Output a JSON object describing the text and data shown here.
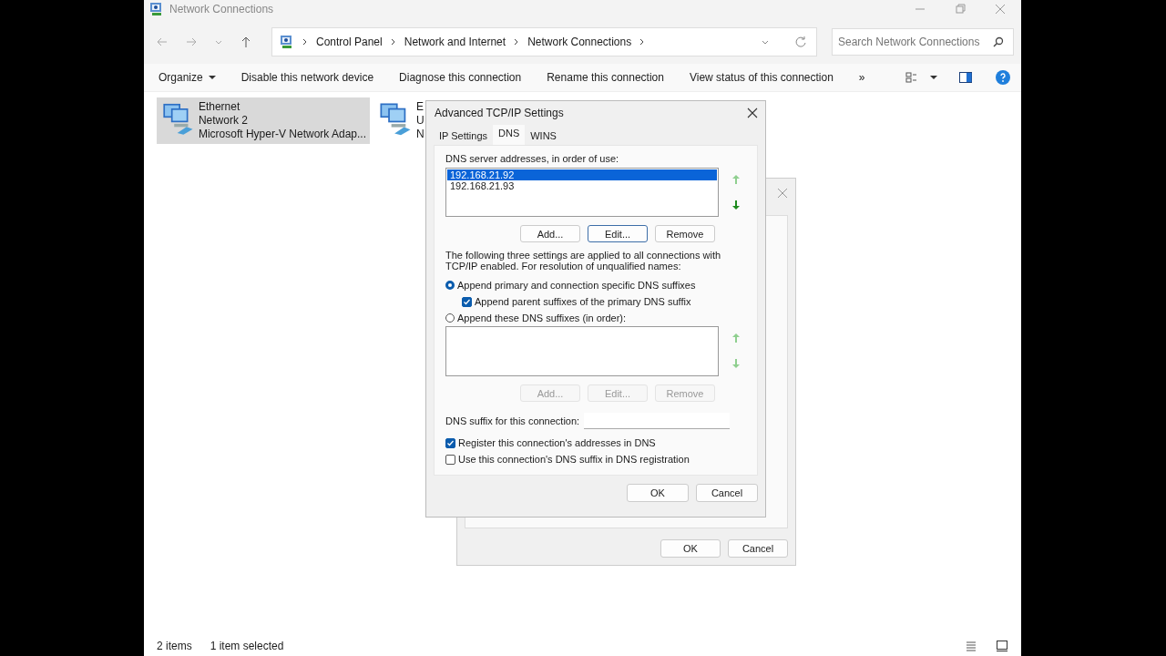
{
  "window": {
    "title": "Network Connections"
  },
  "nav": {
    "breadcrumb": [
      "Control Panel",
      "Network and Internet",
      "Network Connections"
    ],
    "search": {
      "placeholder": "Search Network Connections"
    }
  },
  "commands": [
    {
      "label": "Organize",
      "kind": "menu"
    },
    {
      "label": "Disable this network device",
      "kind": "plain"
    },
    {
      "label": "Diagnose this connection",
      "kind": "plain"
    },
    {
      "label": "Rename this connection",
      "kind": "plain"
    },
    {
      "label": "View status of this connection",
      "kind": "plain"
    },
    {
      "label": "»",
      "kind": "plain"
    }
  ],
  "items": [
    {
      "lines": [
        "Ethernet",
        "Network 2",
        "Microsoft Hyper-V Network Adap..."
      ],
      "selected": true
    },
    {
      "lines": [
        "E",
        "U",
        "N"
      ],
      "selected": false
    }
  ],
  "status_bar": {
    "count": "2 items",
    "selection": "1 item selected"
  },
  "back_dialog": {
    "buttons": [
      "OK",
      "Cancel"
    ]
  },
  "dialog": {
    "title": "Advanced TCP/IP Settings",
    "tabs": [
      {
        "label": "IP Settings",
        "selected": false
      },
      {
        "label": "DNS",
        "selected": true
      },
      {
        "label": "WINS",
        "selected": false
      }
    ],
    "servers_label": "DNS server addresses, in order of use:",
    "servers": [
      {
        "address": "192.168.21.92",
        "selected": true
      },
      {
        "address": "192.168.21.93",
        "selected": false
      }
    ],
    "server_arrows": [
      {
        "kind": "up",
        "disabled": true
      },
      {
        "kind": "down",
        "disabled": false
      }
    ],
    "server_buttons": [
      {
        "label": "Add...",
        "disabled": false,
        "focused": false
      },
      {
        "label": "Edit...",
        "disabled": false,
        "focused": true
      },
      {
        "label": "Remove",
        "disabled": false,
        "focused": false
      }
    ],
    "note": "The following three settings are applied to all connections with TCP/IP enabled. For resolution of unqualified names:",
    "options": [
      {
        "kind": "radio",
        "label": "Append primary and connection specific DNS suffixes",
        "checked": true,
        "children": [
          {
            "kind": "checkbox",
            "label": "Append parent suffixes of the primary DNS suffix",
            "checked": true
          }
        ]
      },
      {
        "kind": "radio",
        "label": "Append these DNS suffixes (in order):",
        "checked": false
      }
    ],
    "suffix_arrows": [
      {
        "kind": "up",
        "disabled": true
      },
      {
        "kind": "down",
        "disabled": true
      }
    ],
    "suffix_buttons": [
      {
        "label": "Add...",
        "disabled": true,
        "focused": false
      },
      {
        "label": "Edit...",
        "disabled": true,
        "focused": false
      },
      {
        "label": "Remove",
        "disabled": true,
        "focused": false
      }
    ],
    "suffix_label": "DNS suffix for this connection:",
    "checks": [
      {
        "label": "Register this connection's addresses in DNS",
        "checked": true
      },
      {
        "label": "Use this connection's DNS suffix in DNS registration",
        "checked": false
      }
    ],
    "buttons": [
      "OK",
      "Cancel"
    ]
  }
}
